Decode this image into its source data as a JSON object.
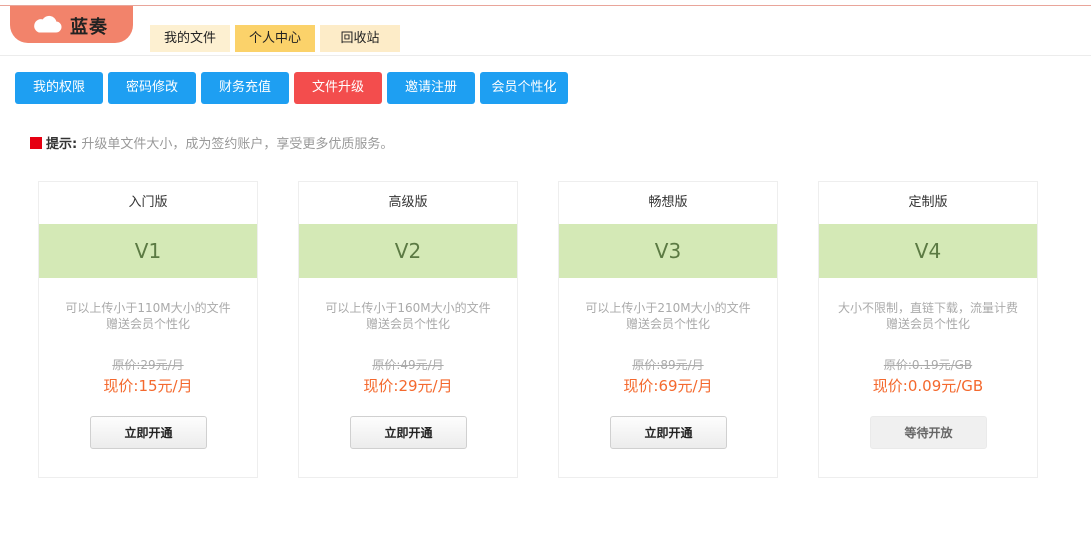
{
  "app": {
    "logo_text": "蓝奏"
  },
  "top_tabs": [
    {
      "label": "我的文件"
    },
    {
      "label": "个人中心"
    },
    {
      "label": "回收站"
    }
  ],
  "sub_nav": [
    {
      "label": "我的权限"
    },
    {
      "label": "密码修改"
    },
    {
      "label": "财务充值"
    },
    {
      "label": "文件升级"
    },
    {
      "label": "邀请注册"
    },
    {
      "label": "会员个性化"
    }
  ],
  "tip": {
    "label": "提示:",
    "text": "升级单文件大小，成为签约账户，享受更多优质服务。"
  },
  "plans": [
    {
      "name": "入门版",
      "level": "V1",
      "desc1": "可以上传小于110M大小的文件",
      "desc2": "赠送会员个性化",
      "orig": "原价:29元/月",
      "now": "现价:15元/月",
      "button": "立即开通"
    },
    {
      "name": "高级版",
      "level": "V2",
      "desc1": "可以上传小于160M大小的文件",
      "desc2": "赠送会员个性化",
      "orig": "原价:49元/月",
      "now": "现价:29元/月",
      "button": "立即开通"
    },
    {
      "name": "畅想版",
      "level": "V3",
      "desc1": "可以上传小于210M大小的文件",
      "desc2": "赠送会员个性化",
      "orig": "原价:89元/月",
      "now": "现价:69元/月",
      "button": "立即开通"
    },
    {
      "name": "定制版",
      "level": "V4",
      "desc1": "大小不限制，直链下载，流量计费",
      "desc2": "赠送会员个性化",
      "orig": "原价:0.19元/GB",
      "now": "现价:0.09元/GB",
      "button": "等待开放"
    }
  ],
  "colors": {
    "accent_blue": "#1e9ff2",
    "active_red": "#f34d4d",
    "price_orange": "#f4692e",
    "level_green": "#d4e9b6"
  }
}
